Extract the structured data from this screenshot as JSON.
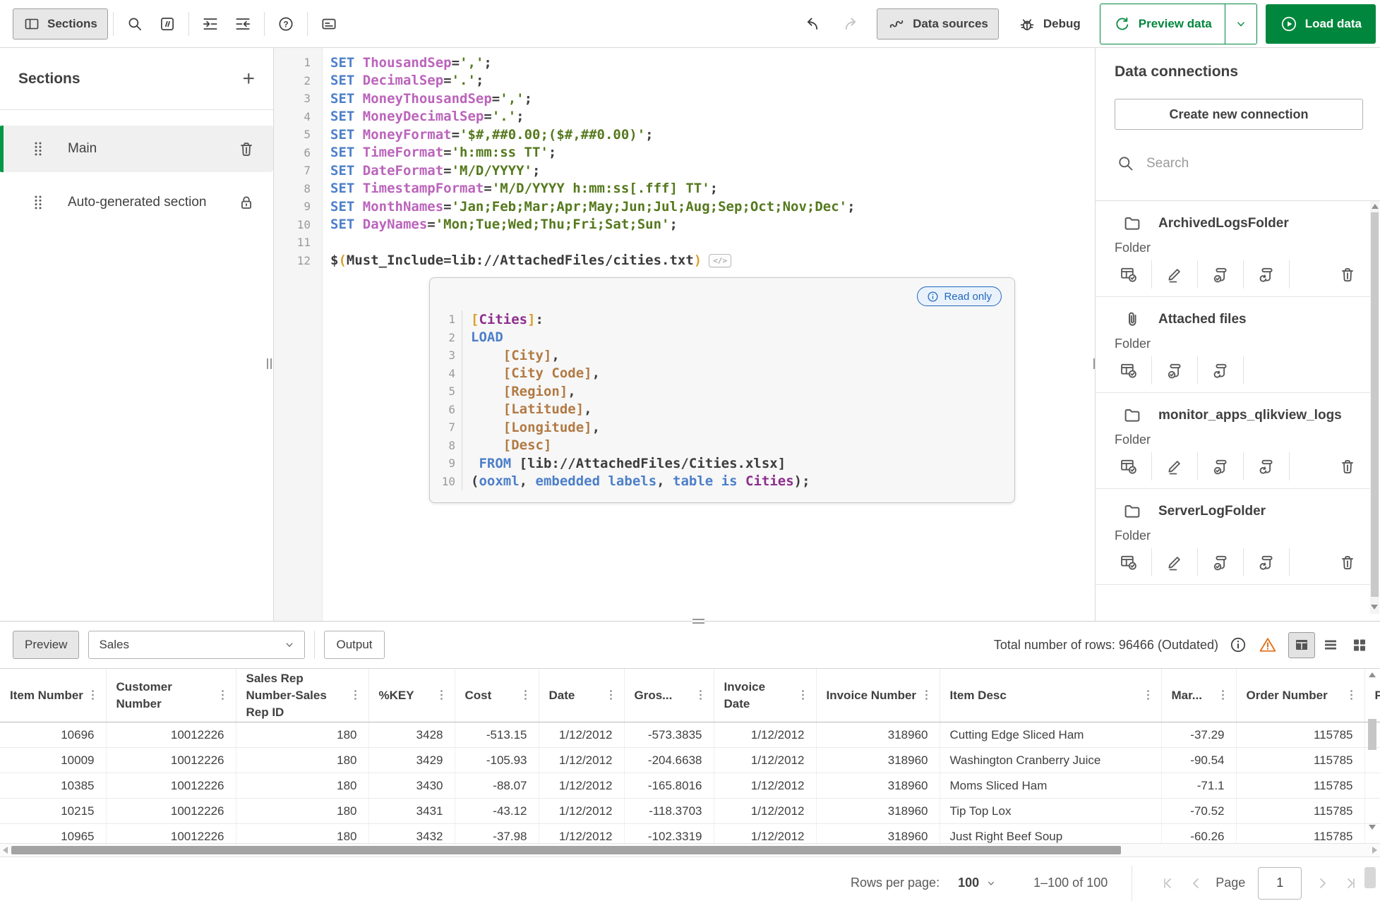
{
  "colors": {
    "accent_green": "#00873d",
    "active_section_green": "#009845",
    "readonly_blue": "#2268bd",
    "warning_orange": "#e2711d",
    "syntax": {
      "keyword": "#4d7fc9",
      "variable": "#bb64bb",
      "string": "#55791d",
      "bracket": "#dca02e",
      "table_name": "#8d2f8d",
      "field": "#b27a44"
    }
  },
  "toolbar": {
    "sections_label": "Sections",
    "left_icons": [
      "sections-panel-icon",
      "search-icon",
      "comment-icon",
      "indent-icon",
      "outdent-icon",
      "help-icon",
      "annotation-icon"
    ],
    "undo_icon": "undo-icon",
    "redo_icon": "redo-icon",
    "data_sources_label": "Data sources",
    "debug_label": "Debug",
    "preview_data_label": "Preview data",
    "load_data_label": "Load data"
  },
  "sections_panel": {
    "title": "Sections",
    "add_icon": "plus-icon",
    "items": [
      {
        "label": "Main",
        "active": true,
        "action_icon": "trash-icon"
      },
      {
        "label": "Auto-generated section",
        "active": false,
        "action_icon": "lock-icon"
      }
    ]
  },
  "editor": {
    "lines": [
      {
        "n": "1",
        "t": [
          [
            "kw",
            "SET "
          ],
          [
            "var",
            "ThousandSep"
          ],
          [
            "pl",
            "="
          ],
          [
            "str",
            "','"
          ],
          [
            "pl",
            ";"
          ]
        ]
      },
      {
        "n": "2",
        "t": [
          [
            "kw",
            "SET "
          ],
          [
            "var",
            "DecimalSep"
          ],
          [
            "pl",
            "="
          ],
          [
            "str",
            "'.'"
          ],
          [
            "pl",
            ";"
          ]
        ]
      },
      {
        "n": "3",
        "t": [
          [
            "kw",
            "SET "
          ],
          [
            "var",
            "MoneyThousandSep"
          ],
          [
            "pl",
            "="
          ],
          [
            "str",
            "','"
          ],
          [
            "pl",
            ";"
          ]
        ]
      },
      {
        "n": "4",
        "t": [
          [
            "kw",
            "SET "
          ],
          [
            "var",
            "MoneyDecimalSep"
          ],
          [
            "pl",
            "="
          ],
          [
            "str",
            "'.'"
          ],
          [
            "pl",
            ";"
          ]
        ]
      },
      {
        "n": "5",
        "t": [
          [
            "kw",
            "SET "
          ],
          [
            "var",
            "MoneyFormat"
          ],
          [
            "pl",
            "="
          ],
          [
            "str",
            "'$#,##0.00;($#,##0.00)'"
          ],
          [
            "pl",
            ";"
          ]
        ]
      },
      {
        "n": "6",
        "t": [
          [
            "kw",
            "SET "
          ],
          [
            "var",
            "TimeFormat"
          ],
          [
            "pl",
            "="
          ],
          [
            "str",
            "'h:mm:ss TT'"
          ],
          [
            "pl",
            ";"
          ]
        ]
      },
      {
        "n": "7",
        "t": [
          [
            "kw",
            "SET "
          ],
          [
            "var",
            "DateFormat"
          ],
          [
            "pl",
            "="
          ],
          [
            "str",
            "'M/D/YYYY'"
          ],
          [
            "pl",
            ";"
          ]
        ]
      },
      {
        "n": "8",
        "t": [
          [
            "kw",
            "SET "
          ],
          [
            "var",
            "TimestampFormat"
          ],
          [
            "pl",
            "="
          ],
          [
            "str",
            "'M/D/YYYY h:mm:ss[.fff] TT'"
          ],
          [
            "pl",
            ";"
          ]
        ]
      },
      {
        "n": "9",
        "t": [
          [
            "kw",
            "SET "
          ],
          [
            "var",
            "MonthNames"
          ],
          [
            "pl",
            "="
          ],
          [
            "str",
            "'Jan;Feb;Mar;Apr;May;Jun;Jul;Aug;Sep;Oct;Nov;Dec'"
          ],
          [
            "pl",
            ";"
          ]
        ]
      },
      {
        "n": "10",
        "t": [
          [
            "kw",
            "SET "
          ],
          [
            "var",
            "DayNames"
          ],
          [
            "pl",
            "="
          ],
          [
            "str",
            "'Mon;Tue;Wed;Thu;Fri;Sat;Sun'"
          ],
          [
            "pl",
            ";"
          ]
        ]
      },
      {
        "n": "11",
        "t": []
      },
      {
        "n": "12",
        "t": [
          [
            "pl",
            "$"
          ],
          [
            "or",
            "("
          ],
          [
            "pl",
            "Must_Include=lib://AttachedFiles/cities.txt"
          ],
          [
            "or",
            ")"
          ]
        ],
        "chip": "</>"
      }
    ]
  },
  "embedded_block": {
    "read_only_label": "Read only",
    "lines": [
      {
        "n": "1",
        "t": [
          [
            "brk",
            "["
          ],
          [
            "tbl",
            "Cities"
          ],
          [
            "brk",
            "]"
          ],
          [
            "pl",
            ":"
          ]
        ]
      },
      {
        "n": "2",
        "t": [
          [
            "kw",
            "LOAD"
          ]
        ]
      },
      {
        "n": "3",
        "t": [
          [
            "pl",
            "    "
          ],
          [
            "fld",
            "[City]"
          ],
          [
            "pl",
            ","
          ]
        ]
      },
      {
        "n": "4",
        "t": [
          [
            "pl",
            "    "
          ],
          [
            "fld",
            "[City Code]"
          ],
          [
            "pl",
            ","
          ]
        ]
      },
      {
        "n": "5",
        "t": [
          [
            "pl",
            "    "
          ],
          [
            "fld",
            "[Region]"
          ],
          [
            "pl",
            ","
          ]
        ]
      },
      {
        "n": "6",
        "t": [
          [
            "pl",
            "    "
          ],
          [
            "fld",
            "[Latitude]"
          ],
          [
            "pl",
            ","
          ]
        ]
      },
      {
        "n": "7",
        "t": [
          [
            "pl",
            "    "
          ],
          [
            "fld",
            "[Longitude]"
          ],
          [
            "pl",
            ","
          ]
        ]
      },
      {
        "n": "8",
        "t": [
          [
            "pl",
            "    "
          ],
          [
            "fld",
            "[Desc]"
          ]
        ]
      },
      {
        "n": "9",
        "t": [
          [
            "pl",
            " "
          ],
          [
            "kw",
            "FROM"
          ],
          [
            "pl",
            " [lib://AttachedFiles/Cities.xlsx]"
          ]
        ]
      },
      {
        "n": "10",
        "t": [
          [
            "pl",
            "("
          ],
          [
            "kw",
            "ooxml"
          ],
          [
            "pl",
            ", "
          ],
          [
            "kw",
            "embedded labels"
          ],
          [
            "pl",
            ", "
          ],
          [
            "kw",
            "table is"
          ],
          [
            "pl",
            " "
          ],
          [
            "tbl",
            "Cities"
          ],
          [
            "pl",
            ");"
          ]
        ]
      }
    ]
  },
  "connections": {
    "title": "Data connections",
    "create_button_label": "Create new connection",
    "search_placeholder": "Search",
    "items": [
      {
        "name": "ArchivedLogsFolder",
        "type": "Folder",
        "icon": "folder",
        "actions": [
          "select-data",
          "edit",
          "load-script",
          "reload-script",
          "delete"
        ]
      },
      {
        "name": "Attached files",
        "type": "Folder",
        "icon": "paperclip",
        "actions": [
          "select-data",
          "load-script",
          "reload-script"
        ]
      },
      {
        "name": "monitor_apps_qlikview_logs",
        "type": "Folder",
        "icon": "folder",
        "actions": [
          "select-data",
          "edit",
          "load-script",
          "reload-script",
          "delete"
        ]
      },
      {
        "name": "ServerLogFolder",
        "type": "Folder",
        "icon": "folder",
        "actions": [
          "select-data",
          "edit",
          "load-script",
          "reload-script",
          "delete"
        ]
      }
    ]
  },
  "preview_panel": {
    "preview_button_label": "Preview",
    "table_select_value": "Sales",
    "output_button_label": "Output",
    "total_rows_text": "Total number of rows: 96466 (Outdated)",
    "view_icons": [
      "table-view-icon",
      "list-view-icon",
      "grid-view-icon"
    ],
    "table": {
      "headers": [
        "Item Number",
        "Customer Number",
        "Sales Rep Number-Sales Rep ID",
        "%KEY",
        "Cost",
        "Date",
        "Gros...",
        "Invoice Date",
        "Invoice Number",
        "Item Desc",
        "Mar...",
        "Order Number",
        "P"
      ],
      "rows": [
        [
          "10696",
          "10012226",
          "180",
          "3428",
          "-513.15",
          "1/12/2012",
          "-573.3835",
          "1/12/2012",
          "318960",
          "Cutting Edge Sliced Ham",
          "-37.29",
          "115785",
          ""
        ],
        [
          "10009",
          "10012226",
          "180",
          "3429",
          "-105.93",
          "1/12/2012",
          "-204.6638",
          "1/12/2012",
          "318960",
          "Washington Cranberry Juice",
          "-90.54",
          "115785",
          ""
        ],
        [
          "10385",
          "10012226",
          "180",
          "3430",
          "-88.07",
          "1/12/2012",
          "-165.8016",
          "1/12/2012",
          "318960",
          "Moms Sliced Ham",
          "-71.1",
          "115785",
          ""
        ],
        [
          "10215",
          "10012226",
          "180",
          "3431",
          "-43.12",
          "1/12/2012",
          "-118.3703",
          "1/12/2012",
          "318960",
          "Tip Top Lox",
          "-70.52",
          "115785",
          ""
        ],
        [
          "10965",
          "10012226",
          "180",
          "3432",
          "-37.98",
          "1/12/2012",
          "-102.3319",
          "1/12/2012",
          "318960",
          "Just Right Beef Soup",
          "-60.26",
          "115785",
          ""
        ]
      ]
    },
    "pagination": {
      "rows_per_page_label": "Rows per page:",
      "rows_per_page_value": "100",
      "range_text": "1–100 of 100",
      "page_label": "Page",
      "page_value": "1"
    }
  }
}
